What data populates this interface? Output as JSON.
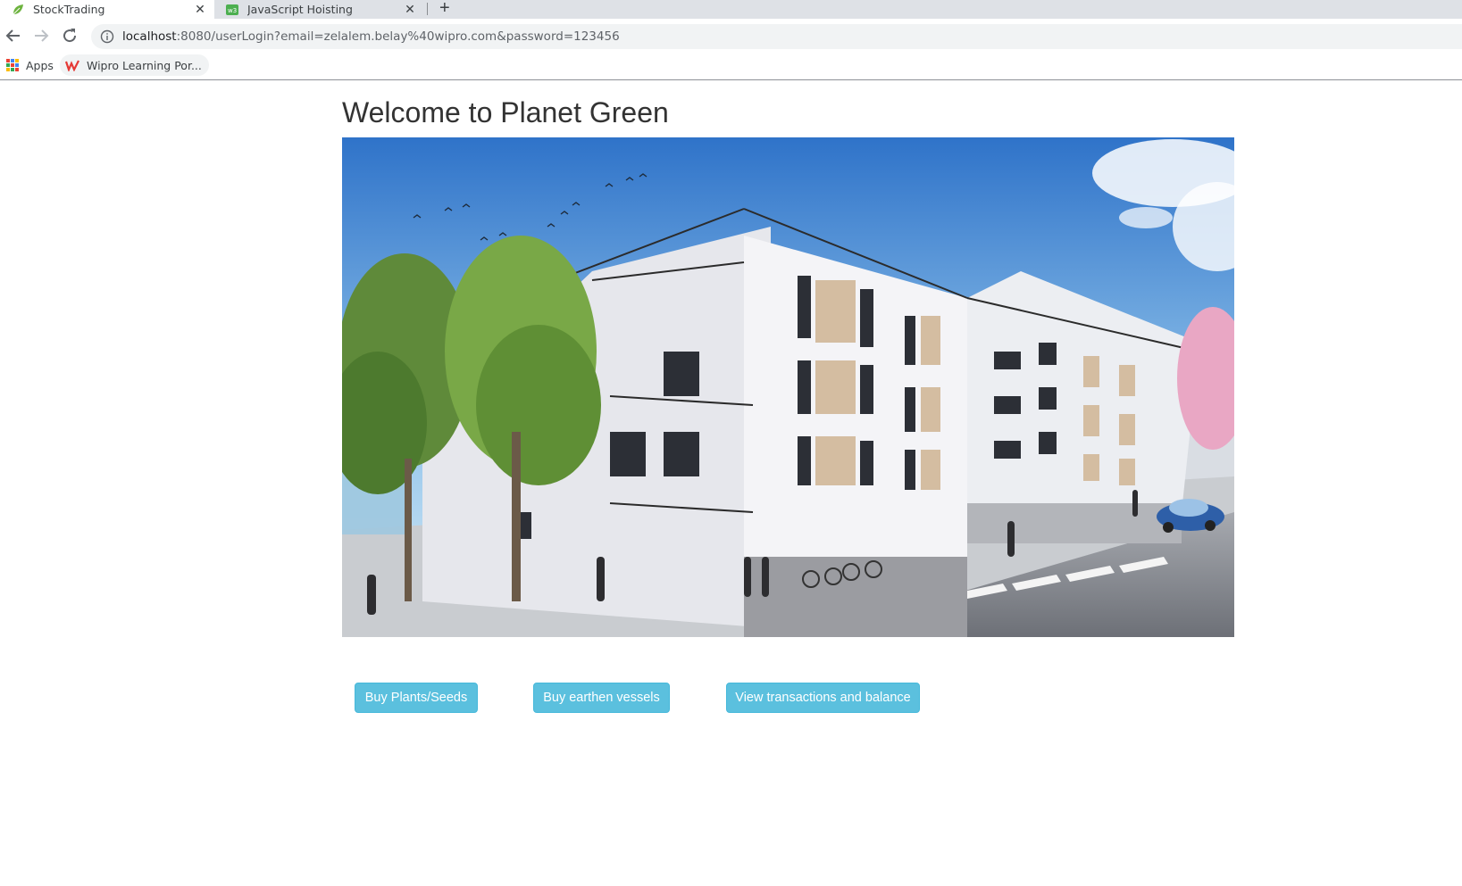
{
  "browser": {
    "tabs": [
      {
        "title": "StockTrading",
        "active": true
      },
      {
        "title": "JavaScript Hoisting",
        "active": false
      }
    ],
    "url": {
      "host": "localhost",
      "path": ":8080/userLogin?email=zelalem.belay%40wipro.com&password=123456"
    },
    "bookmarks": [
      {
        "label": "Apps"
      },
      {
        "label": "Wipro Learning Por..."
      }
    ]
  },
  "page": {
    "title": "Welcome to Planet Green",
    "buttons": {
      "buy_plants": "Buy Plants/Seeds",
      "buy_vessels": "Buy earthen vessels",
      "view_transactions": "View transactions and balance"
    },
    "button_color": "#5bc0de"
  }
}
